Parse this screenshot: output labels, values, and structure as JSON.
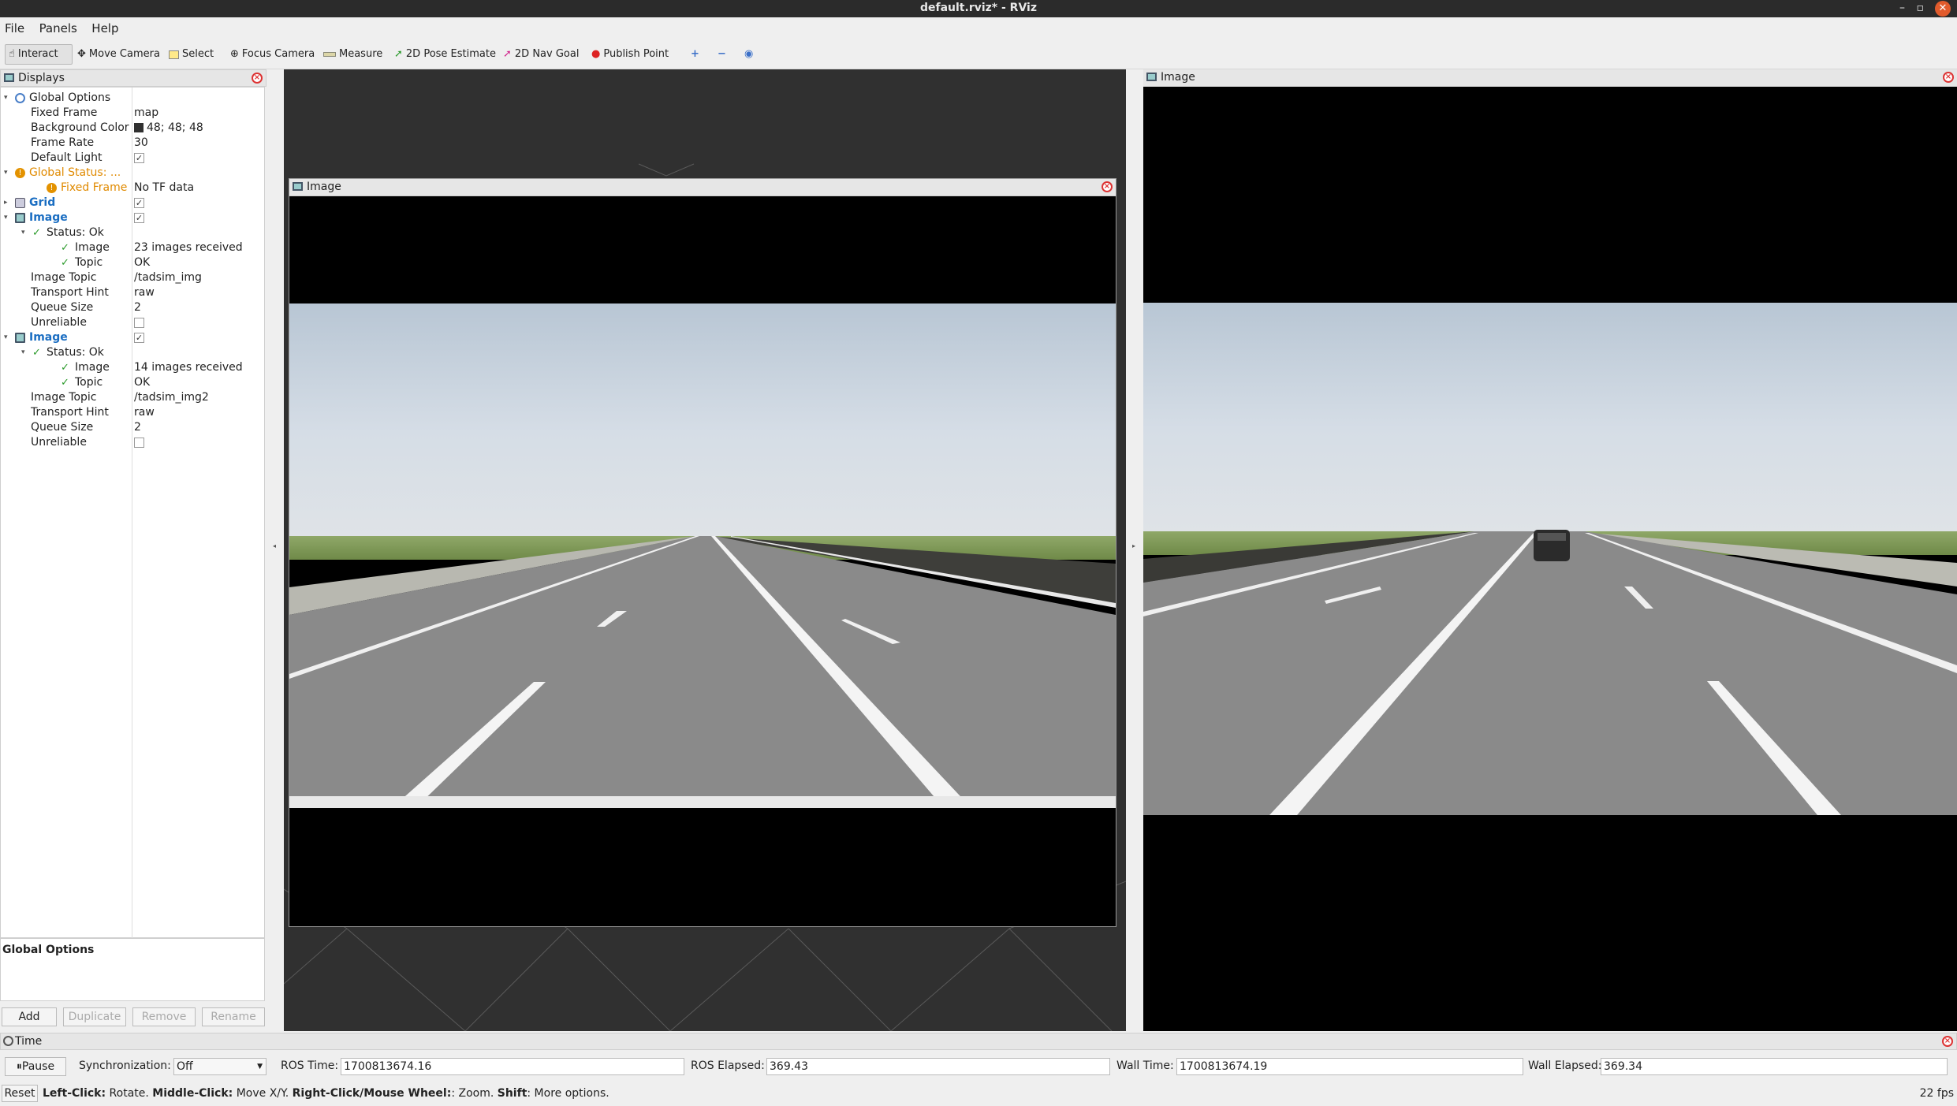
{
  "window": {
    "title": "default.rviz* - RViz",
    "minimize": "–",
    "maximize": "▫",
    "close": "✕"
  },
  "menu": [
    "File",
    "Panels",
    "Help"
  ],
  "toolbar": {
    "tools": [
      {
        "label": "Interact",
        "icon": "hand-pointer-icon",
        "active": true
      },
      {
        "label": "Move Camera",
        "icon": "move-camera-icon"
      },
      {
        "label": "Select",
        "icon": "select-box-icon"
      },
      {
        "label": "Focus Camera",
        "icon": "focus-camera-icon"
      },
      {
        "label": "Measure",
        "icon": "ruler-icon"
      },
      {
        "label": "2D Pose Estimate",
        "icon": "green-arrow-icon"
      },
      {
        "label": "2D Nav Goal",
        "icon": "pink-arrow-icon"
      },
      {
        "label": "Publish Point",
        "icon": "map-pin-icon"
      }
    ],
    "extra_icons": [
      "plus-icon",
      "minus-icon",
      "eye-icon"
    ]
  },
  "displays": {
    "title": "Displays",
    "rows": [
      {
        "label": "Global Options",
        "indent": 0,
        "expand": "▾",
        "icon": "globe-icon"
      },
      {
        "label": "Fixed Frame",
        "value": "map",
        "indent": 2
      },
      {
        "label": "Background Color",
        "value": "48; 48; 48",
        "swatch": "#303030",
        "indent": 2
      },
      {
        "label": "Frame Rate",
        "value": "30",
        "indent": 2
      },
      {
        "label": "Default Light",
        "check": true,
        "indent": 2
      },
      {
        "label": "Global Status: ...",
        "indent": 0,
        "expand": "▾",
        "icon": "warning-icon",
        "style": "orange"
      },
      {
        "label": "Fixed Frame",
        "value": "No TF data",
        "indent": 1,
        "icon": "warning-icon",
        "style": "orange"
      },
      {
        "label": "Grid",
        "check": true,
        "indent": 0,
        "expand": "▸",
        "icon": "grid-icon",
        "style": "blue"
      },
      {
        "label": "Image",
        "check": true,
        "indent": 0,
        "expand": "▾",
        "icon": "image-icon",
        "style": "blue"
      },
      {
        "label": "Status: Ok",
        "indent": 1,
        "expand": "▾",
        "icon": "checkmark-icon"
      },
      {
        "label": "Image",
        "value": "23 images received",
        "indent": 2,
        "icon": "checkmark-icon"
      },
      {
        "label": "Topic",
        "value": "OK",
        "indent": 2,
        "icon": "checkmark-icon"
      },
      {
        "label": "Image Topic",
        "value": "/tadsim_img",
        "indent": 2
      },
      {
        "label": "Transport Hint",
        "value": "raw",
        "indent": 2
      },
      {
        "label": "Queue Size",
        "value": "2",
        "indent": 2
      },
      {
        "label": "Unreliable",
        "check": false,
        "indent": 2
      },
      {
        "label": "Image",
        "check": true,
        "indent": 0,
        "expand": "▾",
        "icon": "image-icon",
        "style": "blue"
      },
      {
        "label": "Status: Ok",
        "indent": 1,
        "expand": "▾",
        "icon": "checkmark-icon"
      },
      {
        "label": "Image",
        "value": "14 images received",
        "indent": 2,
        "icon": "checkmark-icon"
      },
      {
        "label": "Topic",
        "value": "OK",
        "indent": 2,
        "icon": "checkmark-icon"
      },
      {
        "label": "Image Topic",
        "value": "/tadsim_img2",
        "indent": 2
      },
      {
        "label": "Transport Hint",
        "value": "raw",
        "indent": 2
      },
      {
        "label": "Queue Size",
        "value": "2",
        "indent": 2
      },
      {
        "label": "Unreliable",
        "check": false,
        "indent": 2
      }
    ],
    "help_title": "Global Options",
    "buttons": [
      "Add",
      "Duplicate",
      "Remove",
      "Rename"
    ]
  },
  "image_panel_center": {
    "title": "Image"
  },
  "image_panel_right": {
    "title": "Image"
  },
  "time": {
    "title": "Time",
    "pause": "Pause",
    "sync_label": "Synchronization:",
    "sync_value": "Off",
    "ros_time_label": "ROS Time:",
    "ros_time": "1700813674.16",
    "ros_elapsed_label": "ROS Elapsed:",
    "ros_elapsed": "369.43",
    "wall_time_label": "Wall Time:",
    "wall_time": "1700813674.19",
    "wall_elapsed_label": "Wall Elapsed:",
    "wall_elapsed": "369.34"
  },
  "status": {
    "reset": "Reset",
    "b1": "Left-Click:",
    "t1": " Rotate. ",
    "b2": "Middle-Click:",
    "t2": " Move X/Y. ",
    "b3": "Right-Click/Mouse Wheel:",
    "t3": ": Zoom. ",
    "b4": "Shift",
    "t4": ": More options.",
    "fps": "22 fps"
  }
}
